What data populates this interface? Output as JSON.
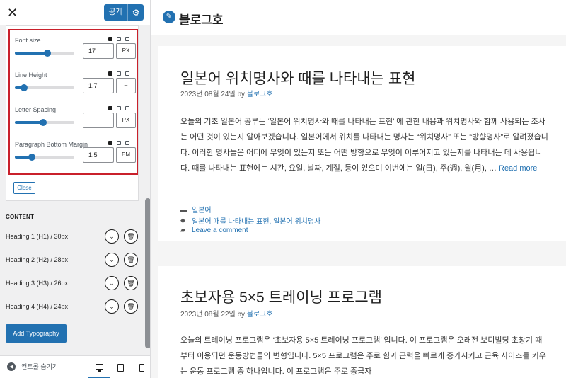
{
  "sidebar": {
    "close_icon": "close-icon",
    "publish_label": "공개",
    "settings_icon": "gear-icon",
    "controls": [
      {
        "label": "Font size",
        "value": "17",
        "unit": "PX",
        "slider_fraction": 0.55
      },
      {
        "label": "Line Height",
        "value": "1.7",
        "unit": "–",
        "slider_fraction": 0.15
      },
      {
        "label": "Letter Spacing",
        "value": "",
        "unit": "PX",
        "slider_fraction": 0.48
      },
      {
        "label": "Paragraph Bottom Margin",
        "value": "1.5",
        "unit": "EM",
        "slider_fraction": 0.28
      }
    ],
    "close_button": "Close",
    "content_heading": "CONTENT",
    "headings": [
      "Heading 1 (H1) / 30px",
      "Heading 2 (H2) / 28px",
      "Heading 3 (H3) / 26px",
      "Heading 4 (H4) / 24px"
    ],
    "add_typography": "Add Typography",
    "footer": {
      "hide_controls": "컨트롤 숨기기",
      "active_device": "desktop"
    },
    "accent_color": "#2271b1",
    "highlight_color": "#c9202b"
  },
  "preview": {
    "site_title": "블로그호",
    "posts": [
      {
        "title": "일본어 위치명사와 때를 나타내는 표현",
        "date": "2023년 08월 24일",
        "by": "by",
        "author": "블로그호",
        "excerpt": "오늘의 기초 일본어 공부는 ‘일본어 위치명사와 때를 나타내는 표현’ 에 관한 내용과 위치명사와 함께 사용되는 조사는 어떤 것이 있는지 알아보겠습니다. 일본어에서 위치를 나타내는 명사는 “위치명사” 또는 “방향명사”로 알려졌습니다. 이러한 명사들은 어디에 무엇이 있는지 또는 어떤 방향으로 무엇이 이루어지고 있는지를 나타내는 데 사용됩니다. 때를 나타내는 표현에는 시간, 요일, 날짜, 계절, 등이 있으며 이번에는 일(日), 주(週), 월(月), …",
        "read_more": "Read more",
        "category": "일본어",
        "tags": "일본어 때를 나타내는 표현, 일본어 위치명사",
        "comment": "Leave a comment"
      },
      {
        "title": "초보자용 5×5 트레이닝 프로그램",
        "date": "2023년 08월 22일",
        "by": "by",
        "author": "블로그호",
        "excerpt": "오늘의 트레이닝 프로그램은 ‘초보자용 5×5 트레이닝 프로그램’ 입니다. 이 프로그램은 오래전 보디빌딩 초창기 때부터 이용되던 운동방법들의 변형입니다. 5×5 프로그램은 주로 힘과 근력을 빠르게 증가시키고 근육 사이즈를 키우는 운동 프로그램 중 하나입니다. 이 프로그램은 주로 중급자"
      }
    ]
  }
}
